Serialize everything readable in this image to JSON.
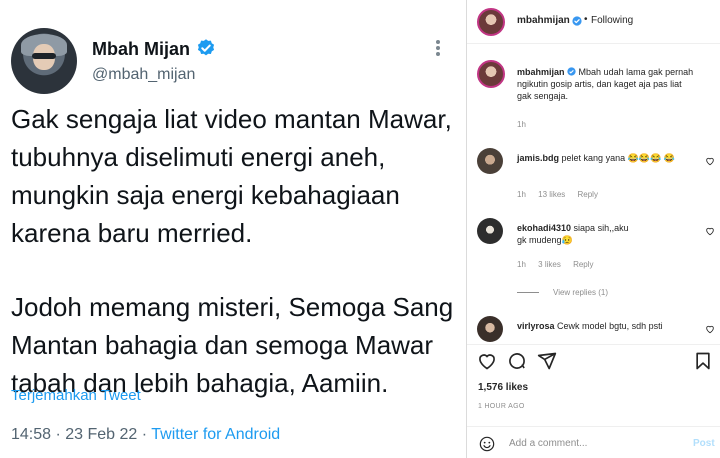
{
  "tweet": {
    "display_name": "Mbah Mijan",
    "handle": "@mbah_mijan",
    "paragraph1": "Gak sengaja liat video mantan Mawar, tubuhnya diselimuti energi aneh, mungkin saja energi kebahagiaan karena baru merried.",
    "paragraph2": "Jodoh memang misteri, Semoga Sang Mantan bahagia dan semoga Mawar tabah dan lebih bahagia, Aamiin.",
    "translate_label": "Terjemahkan Tweet",
    "time_date": "14:58 · 23 Feb 22 · ",
    "source": "Twitter for Android",
    "accent_color": "#1d9bf0"
  },
  "instagram": {
    "header": {
      "username": "mbahmijan",
      "separator": "•",
      "following_label": "Following"
    },
    "caption": {
      "username": "mbahmijan",
      "text": "Mbah udah lama gak pernah ngikutin gosip artis, dan kaget aja pas liat gak sengaja.",
      "age": "1h"
    },
    "comments": [
      {
        "username": "jamis.bdg",
        "text": "pelet kang yana 😂😂😂 😂",
        "age": "1h",
        "likes": "13 likes",
        "reply": "Reply"
      },
      {
        "username": "ekohadi4310",
        "text": "siapa sih,,aku gk mudeng😥",
        "age": "1h",
        "likes": "3 likes",
        "reply": "Reply"
      },
      {
        "username": "virlyrosa",
        "text": "Cewk model bgtu, sdh psti",
        "age": "",
        "likes": "",
        "reply": ""
      }
    ],
    "view_replies": "View replies (1)",
    "likes_count": "1,576 likes",
    "time_ago": "1 HOUR AGO",
    "add_comment_placeholder": "Add a comment...",
    "post_label": "Post"
  }
}
